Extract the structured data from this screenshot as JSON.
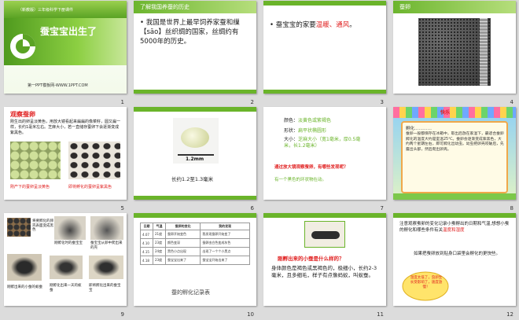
{
  "slides": [
    {
      "num": "1",
      "subtitle": "（新教版）三年级科学下册课件",
      "title": "蚕宝宝出生了",
      "footer": "第一PPT模板网-WWW.1PPT.COM"
    },
    {
      "num": "2",
      "header": "了解我国养蚕的历史",
      "body": "我国是世界上最早饲养家蚕和缫【sāo】丝织绸的国家，丝绸约有5000年的历史。"
    },
    {
      "num": "3",
      "body_pre": "蚕宝宝的家要",
      "body_hl": "温暖、通风",
      "body_post": "。"
    },
    {
      "num": "4",
      "header": "蚕卵"
    },
    {
      "num": "5",
      "title": "观察蚕卵",
      "body": "刚生出的卵呈淡黄色，用放大镜看起来扁扁的像菜籽，圆又扁一样，长约1毫米左右。芝麻大小，若一直储存蚕卵下会逐渐变成紫黑色。",
      "caption_left": "刚产下的蚕卵呈淡黄色",
      "caption_right": "即将孵化的蚕卵呈紫黑色"
    },
    {
      "num": "6",
      "scale": "1.2mm",
      "caption": "长约1.2至1.3毫米"
    },
    {
      "num": "7",
      "color_label": "颜色：",
      "color_value": "淡黄色或紫褐色",
      "shape_label": "形状：",
      "shape_value": "扁平状椭圆形",
      "size_label": "大小：",
      "size_value": "芝麻大小（宽1毫米，厚0.5毫米，长1.2毫米）",
      "question": "通过放大镜观察蚕卵，有哪些发现呢？",
      "answer": "有一个黑色的环状物在动。"
    },
    {
      "num": "8",
      "heading": "孵化…………",
      "dots": "快乐",
      "body": "蚕卵一般都保存在冰箱中，取出后放在家温下，最适合蚕卵孵化的温度大约是室温25℃。蚕卵会逐渐变成紫黑色，大约两个星期左右，即可孵化出幼虫。幼虫把卵壳咬破后，先露出头部，然后爬出卵壳。"
    },
    {
      "num": "9",
      "labels": [
        "将要孵化的卵壳表面变成黑色",
        "刚孵化时的蚕宝宝",
        "蚕宝宝从卵中爬出来的壳",
        "刚孵化出来的蚕宝宝",
        "刚孵出来的小蚕的蚁蚕",
        "刚孵化出来一天的蚁蚕",
        "即将孵化出来的蚕宝宝"
      ]
    },
    {
      "num": "10",
      "table_headers": [
        "日期",
        "气温",
        "蚕卵的变化",
        "我的发现"
      ],
      "table_rows": [
        [
          "4.07",
          "21度",
          "蚕卵开始变色",
          "我发现蚕卵开始变了"
        ],
        [
          "4.10",
          "23度",
          "颜色变深",
          "蚕卵由白色变成灰色"
        ],
        [
          "4.15",
          "24度",
          "黑色小点出现",
          "出现了一个个小黑点"
        ],
        [
          "4.18",
          "23度",
          "蚕宝宝出来了",
          "蚕宝宝开始出来了"
        ]
      ],
      "caption": "蚕的孵化记录表"
    },
    {
      "num": "11",
      "question": "刚孵出来的小蚕是什么样的？",
      "body": "身体颜色是褐色或黑褐色的，极细小，长约2-3毫米，且多细毛，样子有点像蚂蚁，叫蚁蚕。"
    },
    {
      "num": "12",
      "body1_pre": "注意观察蚕卵的变化记录小蚕孵出的日期和气温,想想小蚕的孵化和哪些条件有关",
      "body1_hl": "温度和湿度",
      "body2": "如果把蚕卵放到贴身口袋里会孵化的更快些。",
      "cloud": "温度太低了，虫卵生长受影响了，速度放慢！"
    }
  ],
  "colors": {
    "green": "#6ab42a",
    "red": "#e02020",
    "orange": "#ff6600",
    "text": "#222222"
  }
}
